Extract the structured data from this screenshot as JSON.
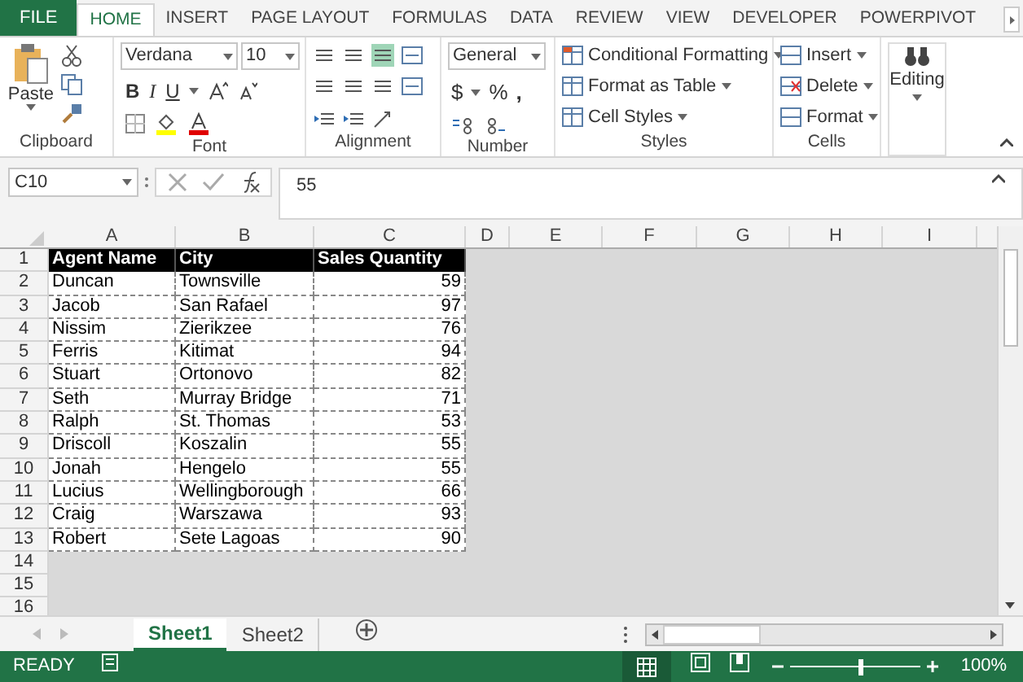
{
  "ribbon_tabs": [
    {
      "label": "FILE",
      "kind": "file",
      "selected": false
    },
    {
      "label": "HOME",
      "kind": "tab",
      "selected": true
    },
    {
      "label": "INSERT",
      "kind": "tab",
      "selected": false
    },
    {
      "label": "PAGE LAYOUT",
      "kind": "tab",
      "selected": false
    },
    {
      "label": "FORMULAS",
      "kind": "tab",
      "selected": false
    },
    {
      "label": "DATA",
      "kind": "tab",
      "selected": false
    },
    {
      "label": "REVIEW",
      "kind": "tab",
      "selected": false
    },
    {
      "label": "VIEW",
      "kind": "tab",
      "selected": false
    },
    {
      "label": "DEVELOPER",
      "kind": "tab",
      "selected": false
    },
    {
      "label": "POWERPIVOT",
      "kind": "tab",
      "selected": false
    }
  ],
  "ribbon": {
    "clipboard": {
      "label": "Clipboard",
      "paste": "Paste"
    },
    "font": {
      "label": "Font",
      "font_name": "Verdana",
      "font_size": "10",
      "bold": "B",
      "italic": "I",
      "underline": "U"
    },
    "alignment": {
      "label": "Alignment"
    },
    "number": {
      "label": "Number",
      "format": "General",
      "currency": "$",
      "percent": "%",
      "comma": ","
    },
    "styles": {
      "label": "Styles",
      "buttons": [
        "Conditional Formatting",
        "Format as Table",
        "Cell Styles"
      ]
    },
    "cells": {
      "label": "Cells",
      "buttons": [
        "Insert",
        "Delete",
        "Format"
      ]
    },
    "editing": {
      "label": "Editing"
    }
  },
  "formula_bar": {
    "name_box": "C10",
    "formula": "55"
  },
  "columns": [
    "A",
    "B",
    "C",
    "D",
    "E",
    "F",
    "G",
    "H",
    "I"
  ],
  "rows": [
    {
      "number": "1",
      "cells": [
        "Agent Name",
        "City",
        "Sales Quantity"
      ],
      "header": true
    },
    {
      "number": "2",
      "cells": [
        "Duncan",
        "Townsville",
        "59"
      ],
      "header": false
    },
    {
      "number": "3",
      "cells": [
        "Jacob",
        "San Rafael",
        "97"
      ],
      "header": false
    },
    {
      "number": "4",
      "cells": [
        "Nissim",
        "Zierikzee",
        "76"
      ],
      "header": false
    },
    {
      "number": "5",
      "cells": [
        "Ferris",
        "Kitimat",
        "94"
      ],
      "header": false
    },
    {
      "number": "6",
      "cells": [
        "Stuart",
        "Ortonovo",
        "82"
      ],
      "header": false
    },
    {
      "number": "7",
      "cells": [
        "Seth",
        "Murray Bridge",
        "71"
      ],
      "header": false
    },
    {
      "number": "8",
      "cells": [
        "Ralph",
        "St. Thomas",
        "53"
      ],
      "header": false
    },
    {
      "number": "9",
      "cells": [
        "Driscoll",
        "Koszalin",
        "55"
      ],
      "header": false
    },
    {
      "number": "10",
      "cells": [
        "Jonah",
        "Hengelo",
        "55"
      ],
      "header": false
    },
    {
      "number": "11",
      "cells": [
        "Lucius",
        "Wellingborough",
        "66"
      ],
      "header": false
    },
    {
      "number": "12",
      "cells": [
        "Craig",
        "Warszawa",
        "93"
      ],
      "header": false
    },
    {
      "number": "13",
      "cells": [
        "Robert",
        "Sete Lagoas",
        "90"
      ],
      "header": false
    },
    {
      "number": "14",
      "cells": []
    },
    {
      "number": "15",
      "cells": []
    },
    {
      "number": "16",
      "cells": []
    }
  ],
  "sheets": [
    {
      "label": "Sheet1",
      "selected": true
    },
    {
      "label": "Sheet2",
      "selected": false
    }
  ],
  "status_bar": {
    "status": "READY",
    "zoom": "100%",
    "zoom_slider": {
      "level": 0.55
    }
  }
}
